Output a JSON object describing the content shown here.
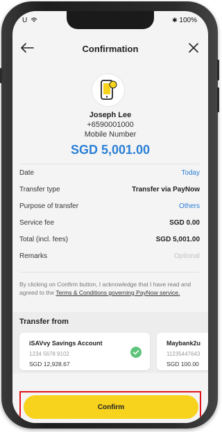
{
  "status_bar": {
    "carrier": "U",
    "battery": "100%"
  },
  "header": {
    "title": "Confirmation"
  },
  "recipient": {
    "name": "Joseph Lee",
    "phone": "+6590001000",
    "type": "Mobile Number"
  },
  "amount": "SGD 5,001.00",
  "details": [
    {
      "label": "Date",
      "value": "Today"
    },
    {
      "label": "Transfer type",
      "value": "Transfer via PayNow"
    },
    {
      "label": "Purpose of transfer",
      "value": "Others"
    },
    {
      "label": "Service fee",
      "value": "SGD 0.00"
    },
    {
      "label": "Total (incl. fees)",
      "value": "SGD 5,001.00"
    },
    {
      "label": "Remarks",
      "value": "Optional"
    }
  ],
  "disclaimer": {
    "prefix": "By clicking on Confirm button, I acknowledge that I have read and agreed to the ",
    "link": "Terms & Conditions governing PayNow service."
  },
  "transfer_from": {
    "title": "Transfer from",
    "accounts": [
      {
        "name": "iSAVvy Savings Account",
        "number": "1234 5678 9102",
        "balance": "SGD 12,928.67"
      },
      {
        "name": "Maybank2u",
        "number": "11235447643",
        "balance": "SGD 100.00"
      }
    ]
  },
  "confirm_label": "Confirm",
  "colors": {
    "accent": "#2a7fd6",
    "button": "#f7d31e",
    "highlight": "#e0141a"
  }
}
